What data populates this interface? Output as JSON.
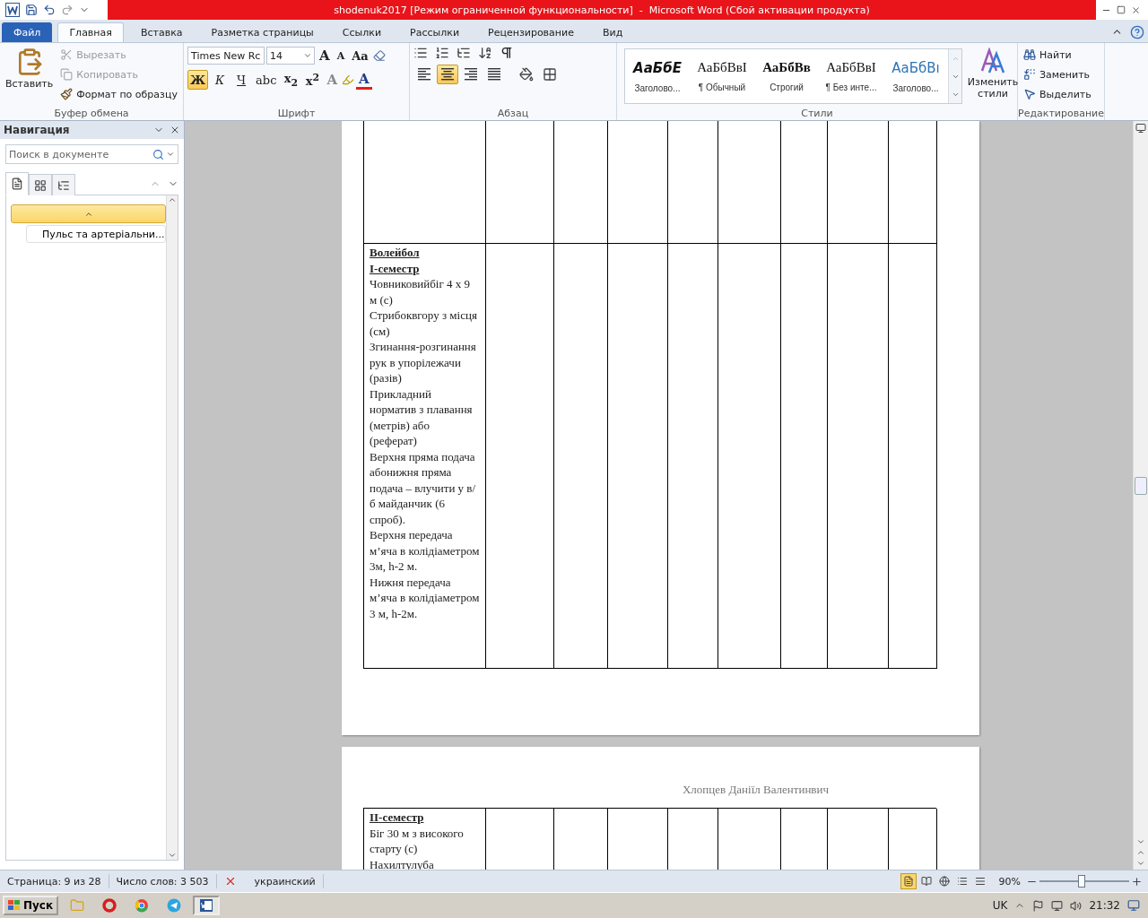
{
  "title_bar": {
    "title": "shodenuk2017 [Режим ограниченной функциональности]  -  Microsoft Word (Сбой активации продукта)"
  },
  "ribbon_tabs": [
    {
      "label": "Файл",
      "kind": "file",
      "selected": false
    },
    {
      "label": "Главная",
      "kind": "tab",
      "selected": true
    },
    {
      "label": "Вставка",
      "kind": "tab",
      "selected": false
    },
    {
      "label": "Разметка страницы",
      "kind": "tab",
      "selected": false
    },
    {
      "label": "Ссылки",
      "kind": "tab",
      "selected": false
    },
    {
      "label": "Рассылки",
      "kind": "tab",
      "selected": false
    },
    {
      "label": "Рецензирование",
      "kind": "tab",
      "selected": false
    },
    {
      "label": "Вид",
      "kind": "tab",
      "selected": false
    }
  ],
  "clipboard": {
    "paste": "Вставить",
    "group_label": "Буфер обмена",
    "actions": [
      {
        "label": "Вырезать",
        "kind": "cut",
        "disabled": true
      },
      {
        "label": "Копировать",
        "kind": "copy",
        "disabled": true
      },
      {
        "label": "Формат по образцу",
        "kind": "painter",
        "disabled": false
      }
    ]
  },
  "font": {
    "name": "Times New Rc",
    "size": "14",
    "grow": "A",
    "shrink": "A",
    "change_case": "Aa",
    "effects": "A",
    "font_color": "A",
    "group_label": "Шрифт",
    "format_buttons": [
      {
        "label": "Ж",
        "kind": "bold",
        "selected": true
      },
      {
        "label": "К",
        "kind": "italic",
        "selected": false
      },
      {
        "label": "Ч",
        "kind": "underline",
        "selected": false
      },
      {
        "label": "abc",
        "kind": "strike",
        "selected": false
      },
      {
        "label": "x$_{2}$",
        "kind": "sub",
        "selected": false
      },
      {
        "label": "x$^{2}$",
        "kind": "sup",
        "selected": false
      }
    ]
  },
  "paragraph": {
    "group_label": "Абзац",
    "alignments": [
      {
        "kind": "left",
        "selected": false
      },
      {
        "kind": "center",
        "selected": true
      },
      {
        "kind": "right",
        "selected": false
      },
      {
        "kind": "justify",
        "selected": false
      }
    ]
  },
  "styles": {
    "group_label": "Стили",
    "change_styles": "Изменить стили",
    "items": [
      {
        "sample": "АаБбЕ",
        "name": "Заголово...",
        "kind": "title"
      },
      {
        "sample": "АаБбВвІ",
        "name": "¶ Обычный",
        "kind": "normal"
      },
      {
        "sample": "АаБбВв",
        "name": "Строгий",
        "kind": "strong"
      },
      {
        "sample": "АаБбВвІ",
        "name": "¶ Без инте...",
        "kind": "normal"
      },
      {
        "sample": "АаБбВı",
        "name": "Заголово...",
        "kind": "heading"
      }
    ]
  },
  "editing": {
    "group_label": "Редактирование",
    "items": [
      {
        "label": "Найти",
        "kind": "find"
      },
      {
        "label": "Заменить",
        "kind": "replace"
      },
      {
        "label": "Выделить",
        "kind": "select"
      }
    ]
  },
  "navigation": {
    "title": "Навигация",
    "search": {
      "placeholder": "Поиск в документе"
    },
    "view_tabs": [
      {
        "kind": "headings",
        "selected": true
      },
      {
        "kind": "pages",
        "selected": false
      },
      {
        "kind": "results",
        "selected": false
      }
    ],
    "outline": [
      {
        "selected": true,
        "expanded": true,
        "children": [
          {
            "label": "Пульс та артеріальни...",
            "selected": false
          }
        ]
      }
    ]
  },
  "page_1": {
    "rows": [
      {
        "cells": [
          {},
          {},
          {},
          {},
          {},
          {},
          {},
          {},
          {}
        ]
      },
      {
        "cells": [
          {
            "lines": [
              {
                "kind": "heading",
                "text": "Волейбол"
              },
              {
                "kind": "heading",
                "text": "І-семестр"
              },
              {
                "kind": "text",
                "text": "Човниковийбіг  4 х 9 м (с)"
              },
              {
                "kind": "text",
                "text": "Стрибоквгору з місця (см)"
              },
              {
                "kind": "text",
                "text": "Згинання-розгинання рук в упорілежачи (разів)"
              },
              {
                "kind": "text",
                "text": "Прикладний норматив з плавання (метрів) або (реферат)"
              },
              {
                "kind": "text",
                "text": "Верхня пряма подача абонижня пряма подача – влучити у в/б майданчик (6 спроб)."
              },
              {
                "kind": "text",
                "text": "Верхня передача м’яча в колідіаметром 3м, h-2 м."
              },
              {
                "kind": "text",
                "text": "Нижня передача м’яча в колідіаметром 3 м, h-2м."
              }
            ]
          },
          {},
          {},
          {},
          {},
          {},
          {},
          {},
          {}
        ]
      }
    ]
  },
  "page_2": {
    "header": "Хлопцев Даніїл Валентинвич",
    "rows": [
      {
        "cells": [
          {
            "lines": [
              {
                "kind": "heading",
                "text": "ІІ-семестр"
              },
              {
                "kind": "text",
                "text": "Біг 30 м з високого старту (с)"
              },
              {
                "kind": "text",
                "text": "Нахилтулуба"
              }
            ]
          },
          {},
          {},
          {},
          {},
          {},
          {},
          {},
          {}
        ]
      }
    ]
  },
  "status_bar": {
    "page": "Страница: 9 из 28",
    "words": "Число слов: 3 503",
    "language": "украинский",
    "zoom": "90%",
    "zoom_slider": {
      "level": 0.47
    },
    "view_buttons": [
      {
        "kind": "print",
        "selected": true
      },
      {
        "kind": "reading",
        "selected": false
      },
      {
        "kind": "web",
        "selected": false
      },
      {
        "kind": "outline",
        "selected": false
      },
      {
        "kind": "draft",
        "selected": false
      }
    ]
  },
  "taskbar": {
    "start": "Пуск",
    "language": "UK",
    "clock": "21:32",
    "apps": [
      {
        "kind": "explorer",
        "selected": false
      },
      {
        "kind": "opera",
        "selected": false
      },
      {
        "kind": "chrome",
        "selected": false
      },
      {
        "kind": "telegram",
        "selected": false
      },
      {
        "kind": "word",
        "selected": true
      }
    ]
  }
}
